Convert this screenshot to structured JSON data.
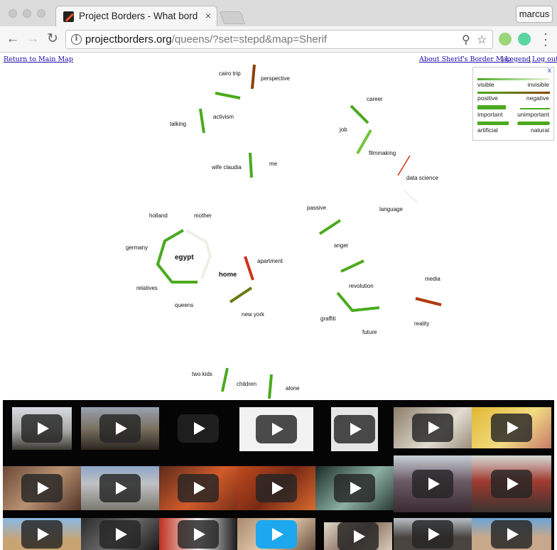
{
  "browser": {
    "tab_title": "Project Borders - What border",
    "tab_close": "×",
    "profile_name": "marcus",
    "url_host": "projectborders.org",
    "url_path": "/queens/?set=stepd&map=Sherif",
    "nav_icons": {
      "back": "arrow-left-icon",
      "forward": "arrow-right-icon",
      "reload": "reload-icon"
    }
  },
  "links": {
    "return": "Return to Main Map",
    "about": "About Sherif's Border Map",
    "legend": "Legend",
    "logout": "Log out",
    "separator": "|"
  },
  "legend": {
    "close": "x",
    "rows": [
      {
        "left": "visible",
        "right": "invisible"
      },
      {
        "left": "positive",
        "right": "negative"
      },
      {
        "left": "important",
        "right": "unimportant"
      },
      {
        "left": "artificial",
        "right": "natural"
      }
    ]
  },
  "colors": {
    "green": "#4aaa1e",
    "dark_brown": "#8a4208",
    "rust": "#b03a0c",
    "olive": "#6a7a10",
    "red": "#cc3319",
    "faint": "#f0eee6",
    "light_green": "#78c23c",
    "blue_play": "#1da7ee"
  },
  "map": {
    "words": [
      {
        "id": "cairo-trip",
        "text": "cairo trip"
      },
      {
        "id": "perspective",
        "text": "perspective"
      },
      {
        "id": "activism",
        "text": "activism"
      },
      {
        "id": "talking",
        "text": "talking"
      },
      {
        "id": "wife-claudia",
        "text": "wife claudia"
      },
      {
        "id": "me",
        "text": "me"
      },
      {
        "id": "career",
        "text": "career"
      },
      {
        "id": "job",
        "text": "job"
      },
      {
        "id": "filmmaking",
        "text": "filmmaking"
      },
      {
        "id": "data-science",
        "text": "data science"
      },
      {
        "id": "language",
        "text": "language"
      },
      {
        "id": "passive",
        "text": "passive"
      },
      {
        "id": "holland",
        "text": "holland"
      },
      {
        "id": "mother",
        "text": "mother"
      },
      {
        "id": "germany",
        "text": "germany"
      },
      {
        "id": "egypt",
        "text": "egypt"
      },
      {
        "id": "relatives",
        "text": "relatives"
      },
      {
        "id": "queens",
        "text": "queens"
      },
      {
        "id": "home",
        "text": "home"
      },
      {
        "id": "apartment",
        "text": "apartment"
      },
      {
        "id": "new-york",
        "text": "new york"
      },
      {
        "id": "anger",
        "text": "anger"
      },
      {
        "id": "revolution",
        "text": "revolution"
      },
      {
        "id": "graffiti",
        "text": "graffiti"
      },
      {
        "id": "future",
        "text": "future"
      },
      {
        "id": "media",
        "text": "media"
      },
      {
        "id": "reality",
        "text": "reality"
      },
      {
        "id": "two-kids",
        "text": "two kids"
      },
      {
        "id": "children",
        "text": "children"
      },
      {
        "id": "alone",
        "text": "alone"
      }
    ]
  },
  "videos": [
    {
      "id": "v1",
      "play": "play-icon"
    },
    {
      "id": "v2",
      "play": "play-icon"
    },
    {
      "id": "v3",
      "play": "play-icon"
    },
    {
      "id": "v4",
      "play": "play-icon"
    },
    {
      "id": "v5",
      "play": "play-icon"
    },
    {
      "id": "v6",
      "play": "play-icon"
    },
    {
      "id": "v7",
      "play": "play-icon"
    },
    {
      "id": "v8",
      "play": "play-icon"
    },
    {
      "id": "v9",
      "play": "play-icon"
    },
    {
      "id": "v10",
      "play": "play-icon"
    },
    {
      "id": "v11",
      "play": "play-icon"
    },
    {
      "id": "v12",
      "play": "play-icon"
    },
    {
      "id": "v13",
      "play": "play-icon"
    },
    {
      "id": "v14",
      "play": "play-icon"
    },
    {
      "id": "v15",
      "play": "play-icon"
    },
    {
      "id": "v16",
      "play": "play-icon"
    },
    {
      "id": "v17",
      "play": "play-icon"
    },
    {
      "id": "v18",
      "play": "play-icon"
    },
    {
      "id": "v19",
      "play": "play-icon"
    },
    {
      "id": "v20",
      "play": "play-icon"
    },
    {
      "id": "v21",
      "play": "play-icon"
    }
  ]
}
